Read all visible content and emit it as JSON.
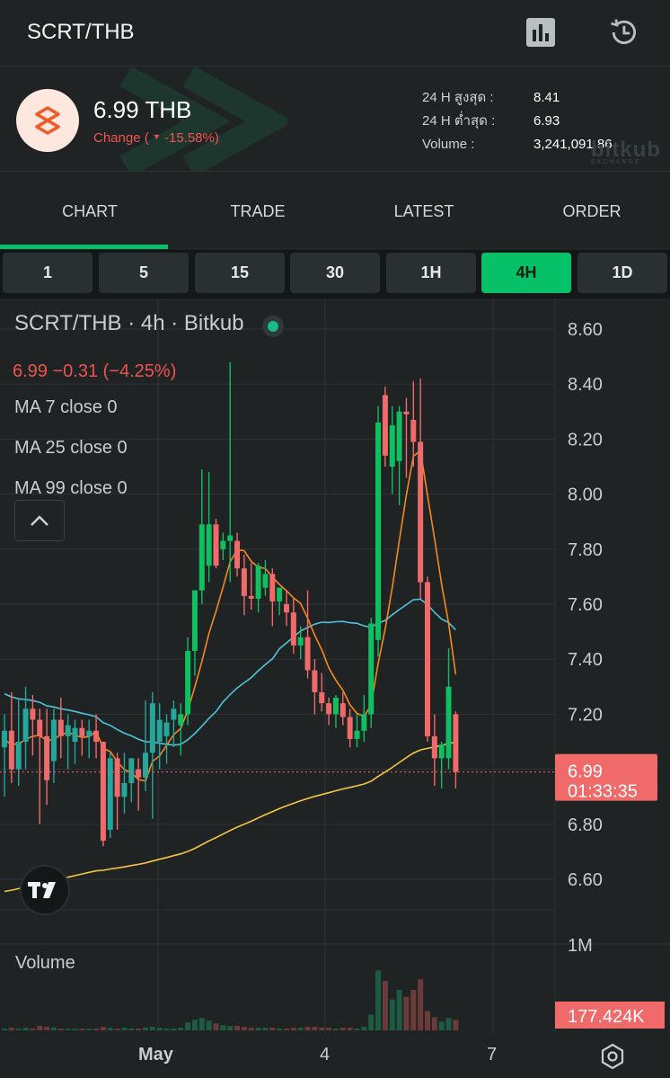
{
  "header": {
    "pair": "SCRT/THB",
    "icons": [
      "chart-icon",
      "history-icon"
    ]
  },
  "ticker": {
    "price": "6.99 THB",
    "change_label": "Change (",
    "change_arrow": "▼",
    "change_value": "-15.58%)",
    "stats": [
      {
        "label": "24 H สูงสุด :",
        "value": "8.41"
      },
      {
        "label": "24 H ต่ำสุด :",
        "value": "6.93"
      },
      {
        "label": "Volume :",
        "value": "3,241,091.86"
      }
    ],
    "watermark": "bitkub",
    "watermark_sub": "EXCHANGE",
    "colors": {
      "down": "#ef5350",
      "logo_bg": "#fde7de",
      "logo_fg": "#f05a28"
    }
  },
  "tabs": [
    {
      "label": "CHART",
      "active": true
    },
    {
      "label": "TRADE",
      "active": false
    },
    {
      "label": "LATEST",
      "active": false
    },
    {
      "label": "ORDER",
      "active": false
    }
  ],
  "intervals": [
    {
      "label": "1",
      "active": false
    },
    {
      "label": "5",
      "active": false
    },
    {
      "label": "15",
      "active": false
    },
    {
      "label": "30",
      "active": false
    },
    {
      "label": "1H",
      "active": false
    },
    {
      "label": "4H",
      "active": true
    },
    {
      "label": "1D",
      "active": false
    }
  ],
  "legend": {
    "title": "SCRT/THB · 4h · Bitkub",
    "ohlc": "6.99  −0.31 (−4.25%)",
    "ma": [
      "MA 7 close 0",
      "MA 25 close 0",
      "MA 99 close 0"
    ]
  },
  "volume_label": "Volume",
  "chart_data": {
    "type": "candlestick",
    "y_ticks": [
      "8.60",
      "8.40",
      "8.20",
      "8.00",
      "7.80",
      "7.60",
      "7.40",
      "7.20",
      "6.80",
      "6.60"
    ],
    "ylim": [
      6.5,
      8.66
    ],
    "current_price": "6.99",
    "countdown": "01:33:35",
    "volume_tick": "1M",
    "volume_current": "177.424K",
    "x_ticks": [
      "May",
      "4",
      "7"
    ],
    "colors": {
      "up": "#26a69a",
      "up_bright": "#0fbf60",
      "down": "#f06a6a",
      "ma7": "#f5891f",
      "ma25": "#4fc3d9",
      "ma99": "#f5c542"
    },
    "candles": [
      {
        "o": 7.08,
        "h": 7.2,
        "l": 6.9,
        "c": 7.14
      },
      {
        "o": 7.14,
        "h": 7.28,
        "l": 6.95,
        "c": 7.0
      },
      {
        "o": 7.0,
        "h": 7.26,
        "l": 6.94,
        "c": 7.1
      },
      {
        "o": 7.1,
        "h": 7.3,
        "l": 7.0,
        "c": 7.22
      },
      {
        "o": 7.22,
        "h": 7.27,
        "l": 7.05,
        "c": 7.18
      },
      {
        "o": 7.18,
        "h": 7.22,
        "l": 6.8,
        "c": 7.12
      },
      {
        "o": 7.12,
        "h": 7.22,
        "l": 6.87,
        "c": 6.96
      },
      {
        "o": 7.03,
        "h": 7.22,
        "l": 6.95,
        "c": 7.18
      },
      {
        "o": 7.18,
        "h": 7.26,
        "l": 7.04,
        "c": 7.12
      },
      {
        "o": 7.12,
        "h": 7.2,
        "l": 7.0,
        "c": 7.16
      },
      {
        "o": 7.1,
        "h": 7.18,
        "l": 7.02,
        "c": 7.15
      },
      {
        "o": 7.15,
        "h": 7.18,
        "l": 7.05,
        "c": 7.12
      },
      {
        "o": 7.12,
        "h": 7.18,
        "l": 7.04,
        "c": 7.14
      },
      {
        "o": 7.14,
        "h": 7.2,
        "l": 7.04,
        "c": 7.1
      },
      {
        "o": 7.1,
        "h": 7.06,
        "l": 6.72,
        "c": 6.74
      },
      {
        "o": 6.78,
        "h": 7.06,
        "l": 6.75,
        "c": 7.04
      },
      {
        "o": 7.04,
        "h": 7.06,
        "l": 6.78,
        "c": 6.9
      },
      {
        "o": 6.9,
        "h": 7.06,
        "l": 6.84,
        "c": 6.95
      },
      {
        "o": 6.95,
        "h": 7.04,
        "l": 6.88,
        "c": 7.04
      },
      {
        "o": 7.0,
        "h": 7.04,
        "l": 6.85,
        "c": 6.97
      },
      {
        "o": 6.97,
        "h": 7.25,
        "l": 6.92,
        "c": 7.06
      },
      {
        "o": 7.06,
        "h": 7.28,
        "l": 6.82,
        "c": 7.24
      },
      {
        "o": 7.1,
        "h": 7.24,
        "l": 7.0,
        "c": 7.18
      },
      {
        "o": 7.12,
        "h": 7.2,
        "l": 7.02,
        "c": 7.17
      },
      {
        "o": 7.18,
        "h": 7.25,
        "l": 7.08,
        "c": 7.22
      },
      {
        "o": 7.16,
        "h": 7.24,
        "l": 7.05,
        "c": 7.2
      },
      {
        "o": 7.2,
        "h": 7.48,
        "l": 7.16,
        "c": 7.43
      },
      {
        "o": 7.43,
        "h": 7.65,
        "l": 7.34,
        "c": 7.65
      },
      {
        "o": 7.65,
        "h": 8.09,
        "l": 7.6,
        "c": 7.89
      },
      {
        "o": 7.74,
        "h": 8.08,
        "l": 7.68,
        "c": 7.89
      },
      {
        "o": 7.89,
        "h": 7.91,
        "l": 7.73,
        "c": 7.74
      },
      {
        "o": 7.8,
        "h": 7.86,
        "l": 7.76,
        "c": 7.83
      },
      {
        "o": 7.83,
        "h": 8.48,
        "l": 7.68,
        "c": 7.85
      },
      {
        "o": 7.83,
        "h": 7.86,
        "l": 7.7,
        "c": 7.73
      },
      {
        "o": 7.73,
        "h": 7.78,
        "l": 7.56,
        "c": 7.63
      },
      {
        "o": 7.63,
        "h": 7.75,
        "l": 7.58,
        "c": 7.62
      },
      {
        "o": 7.62,
        "h": 7.75,
        "l": 7.57,
        "c": 7.74
      },
      {
        "o": 7.66,
        "h": 7.76,
        "l": 7.63,
        "c": 7.71
      },
      {
        "o": 7.71,
        "h": 7.73,
        "l": 7.52,
        "c": 7.61
      },
      {
        "o": 7.61,
        "h": 7.66,
        "l": 7.56,
        "c": 7.66
      },
      {
        "o": 7.6,
        "h": 7.65,
        "l": 7.52,
        "c": 7.57
      },
      {
        "o": 7.57,
        "h": 7.62,
        "l": 7.42,
        "c": 7.45
      },
      {
        "o": 7.45,
        "h": 7.52,
        "l": 7.4,
        "c": 7.48
      },
      {
        "o": 7.48,
        "h": 7.65,
        "l": 7.33,
        "c": 7.36
      },
      {
        "o": 7.36,
        "h": 7.4,
        "l": 7.2,
        "c": 7.28
      },
      {
        "o": 7.28,
        "h": 7.35,
        "l": 7.21,
        "c": 7.24
      },
      {
        "o": 7.24,
        "h": 7.26,
        "l": 7.16,
        "c": 7.2
      },
      {
        "o": 7.2,
        "h": 7.27,
        "l": 7.15,
        "c": 7.26
      },
      {
        "o": 7.24,
        "h": 7.28,
        "l": 7.16,
        "c": 7.19
      },
      {
        "o": 7.19,
        "h": 7.22,
        "l": 7.08,
        "c": 7.11
      },
      {
        "o": 7.11,
        "h": 7.2,
        "l": 7.08,
        "c": 7.14
      },
      {
        "o": 7.14,
        "h": 7.27,
        "l": 7.1,
        "c": 7.2
      },
      {
        "o": 7.2,
        "h": 7.55,
        "l": 7.15,
        "c": 7.53
      },
      {
        "o": 7.47,
        "h": 8.32,
        "l": 7.41,
        "c": 8.26
      },
      {
        "o": 8.36,
        "h": 8.39,
        "l": 8.1,
        "c": 8.14
      },
      {
        "o": 8.1,
        "h": 8.32,
        "l": 8.0,
        "c": 8.25
      },
      {
        "o": 8.12,
        "h": 8.32,
        "l": 7.96,
        "c": 8.3
      },
      {
        "o": 8.3,
        "h": 8.35,
        "l": 8.06,
        "c": 8.29
      },
      {
        "o": 8.27,
        "h": 8.41,
        "l": 8.1,
        "c": 8.19
      },
      {
        "o": 8.19,
        "h": 8.42,
        "l": 7.62,
        "c": 7.68
      },
      {
        "o": 7.68,
        "h": 7.7,
        "l": 7.1,
        "c": 7.12
      },
      {
        "o": 7.12,
        "h": 7.2,
        "l": 6.94,
        "c": 7.04
      },
      {
        "o": 7.04,
        "h": 7.1,
        "l": 6.93,
        "c": 7.09
      },
      {
        "o": 7.04,
        "h": 7.44,
        "l": 7.0,
        "c": 7.3
      },
      {
        "o": 7.2,
        "h": 7.21,
        "l": 6.93,
        "c": 6.99
      }
    ],
    "volumes": [
      0.02,
      0.03,
      0.02,
      0.03,
      0.02,
      0.05,
      0.04,
      0.03,
      0.02,
      0.02,
      0.02,
      0.02,
      0.02,
      0.02,
      0.04,
      0.03,
      0.02,
      0.03,
      0.02,
      0.02,
      0.03,
      0.04,
      0.03,
      0.02,
      0.02,
      0.03,
      0.09,
      0.12,
      0.14,
      0.11,
      0.08,
      0.06,
      0.05,
      0.05,
      0.04,
      0.03,
      0.03,
      0.03,
      0.03,
      0.02,
      0.02,
      0.03,
      0.03,
      0.04,
      0.04,
      0.03,
      0.03,
      0.02,
      0.03,
      0.03,
      0.02,
      0.04,
      0.18,
      0.68,
      0.56,
      0.35,
      0.46,
      0.38,
      0.46,
      0.58,
      0.22,
      0.15,
      0.1,
      0.14,
      0.12
    ]
  }
}
